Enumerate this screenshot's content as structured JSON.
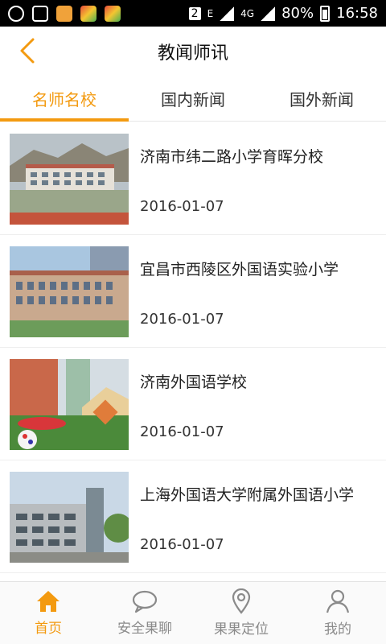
{
  "status_bar": {
    "sim_badge": "2",
    "network_type": "E",
    "network_4g": "4G",
    "battery_percent": "80%",
    "time": "16:58"
  },
  "header": {
    "title": "教闻师讯"
  },
  "tabs": [
    {
      "label": "名师名校",
      "active": true
    },
    {
      "label": "国内新闻",
      "active": false
    },
    {
      "label": "国外新闻",
      "active": false
    }
  ],
  "news": [
    {
      "title": "济南市纬二路小学育晖分校",
      "date": "2016-01-07",
      "thumb": "school-building-image"
    },
    {
      "title": "宜昌市西陵区外国语实验小学",
      "date": "2016-01-07",
      "thumb": "school-building-image"
    },
    {
      "title": "济南外国语学校",
      "date": "2016-01-07",
      "thumb": "school-garden-image"
    },
    {
      "title": "上海外国语大学附属外国语小学",
      "date": "2016-01-07",
      "thumb": "school-building-image"
    }
  ],
  "bottom_nav": [
    {
      "label": "首页",
      "icon": "home-icon",
      "active": true
    },
    {
      "label": "安全果聊",
      "icon": "chat-icon",
      "active": false
    },
    {
      "label": "果果定位",
      "icon": "location-icon",
      "active": false
    },
    {
      "label": "我的",
      "icon": "person-icon",
      "active": false
    }
  ],
  "colors": {
    "accent": "#f39a10",
    "inactive": "#8a8a8a"
  }
}
